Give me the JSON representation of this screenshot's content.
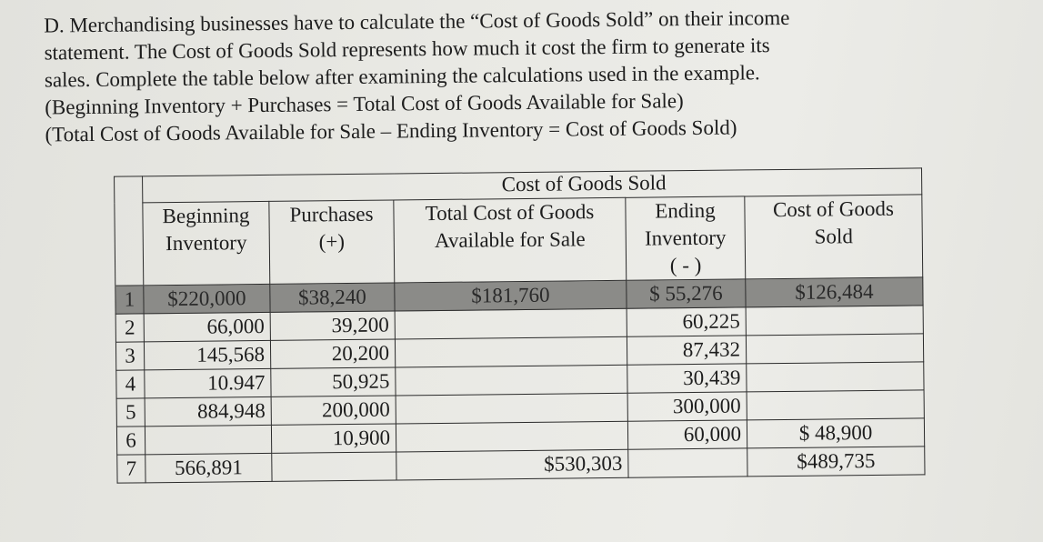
{
  "intro": {
    "lines": [
      "D. Merchandising businesses have to calculate the “Cost of Goods Sold” on their income",
      "statement.  The Cost of Goods Sold represents how much it cost the firm to generate its",
      "sales.  Complete the table below after examining the calculations used in the example.",
      "(Beginning Inventory + Purchases = Total Cost of Goods Available for Sale)",
      "(Total Cost of Goods Available for Sale – Ending Inventory = Cost of Goods Sold)"
    ]
  },
  "table": {
    "group_title": "Cost of Goods Sold",
    "headers": [
      {
        "line1": "Beginning",
        "line2": "Inventory",
        "line3": ""
      },
      {
        "line1": "Purchases",
        "line2": "(+)",
        "line3": ""
      },
      {
        "line1": "Total Cost of Goods",
        "line2": "Available for Sale",
        "line3": ""
      },
      {
        "line1": "Ending",
        "line2": "Inventory",
        "line3": "( - )"
      },
      {
        "line1": "Cost of Goods",
        "line2": "Sold",
        "line3": ""
      }
    ],
    "rows": [
      {
        "n": "1",
        "beginning": "$220,000",
        "purchases": "$38,240",
        "total": "$181,760",
        "ending": "$ 55,276",
        "cogs": "$126,484",
        "example": true
      },
      {
        "n": "2",
        "beginning": "66,000",
        "purchases": "39,200",
        "total": "",
        "ending": "60,225",
        "cogs": ""
      },
      {
        "n": "3",
        "beginning": "145,568",
        "purchases": "20,200",
        "total": "",
        "ending": "87,432",
        "cogs": ""
      },
      {
        "n": "4",
        "beginning": "10.947",
        "purchases": "50,925",
        "total": "",
        "ending": "30,439",
        "cogs": ""
      },
      {
        "n": "5",
        "beginning": "884,948",
        "purchases": "200,000",
        "total": "",
        "ending": "300,000",
        "cogs": ""
      },
      {
        "n": "6",
        "beginning": "",
        "purchases": "10,900",
        "total": "",
        "ending": "60,000",
        "cogs": "$ 48,900"
      },
      {
        "n": "7",
        "beginning": "566,891",
        "purchases": "",
        "total": "$530,303",
        "ending": "",
        "cogs": "$489,735"
      }
    ]
  }
}
